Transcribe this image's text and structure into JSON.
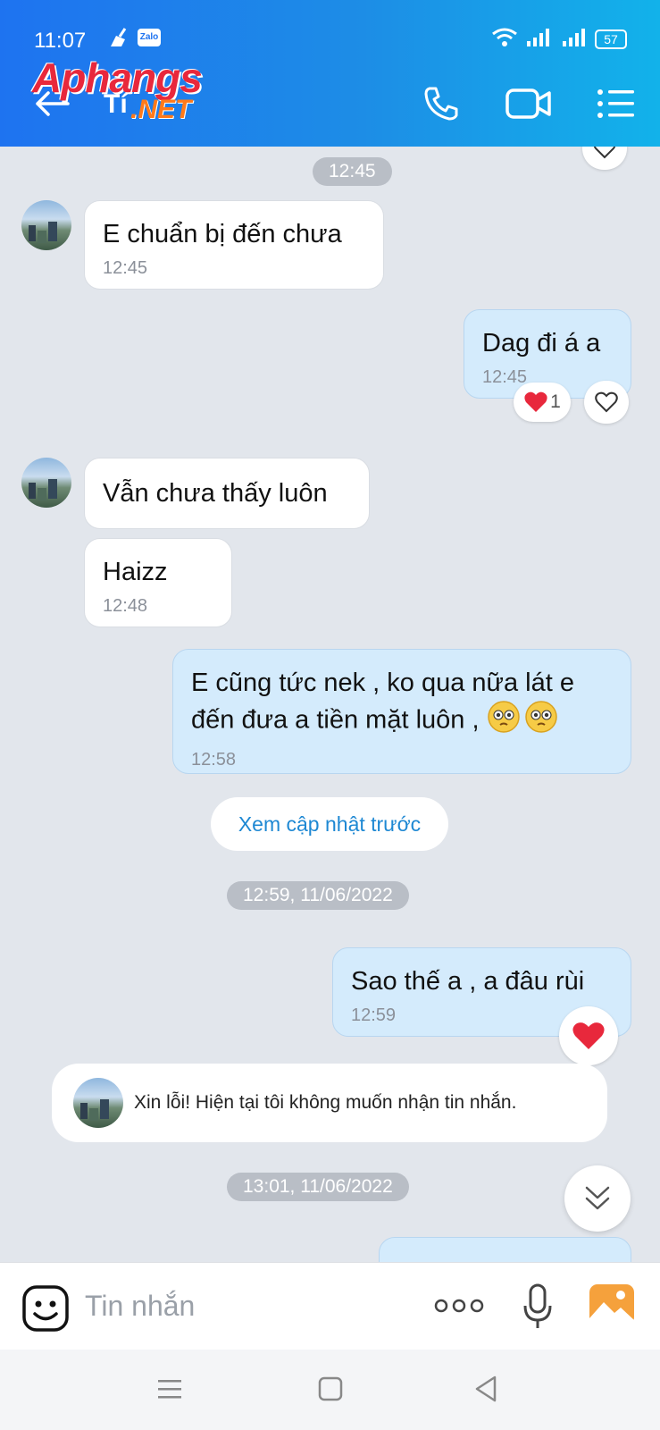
{
  "status_bar": {
    "time": "11:07",
    "battery": "57",
    "app_badge": "Zalo"
  },
  "header": {
    "watermark_main": "Aphangs",
    "watermark_sub1": "Tí",
    "watermark_sub2": ".NET",
    "icons": [
      "back-arrow-icon",
      "phone-icon",
      "video-call-icon",
      "menu-list-icon"
    ]
  },
  "chat": {
    "time_divider_1": "12:45",
    "msg1": {
      "text": "E chuẩn bị đến chưa",
      "time": "12:45"
    },
    "msg2": {
      "text": "Dag đi á a",
      "time": "12:45",
      "reaction_count": "1"
    },
    "msg3": {
      "text": "Vẫn chưa thấy luôn"
    },
    "msg4": {
      "text": "Haizz",
      "time": "12:48"
    },
    "msg5": {
      "line1": "E cũng tức nek , ko qua nữa lát e",
      "line2": "đến đưa a tiền mặt luôn ,",
      "time": "12:58"
    },
    "load_previous": "Xem cập nhật trước",
    "time_divider_2": "12:59, 11/06/2022",
    "msg6": {
      "text": "Sao thế a  , a đâu rùi",
      "time": "12:59"
    },
    "auto_reply": "Xin lỗi! Hiện tại tôi không muốn nhận tin nhắn.",
    "time_divider_3": "13:01, 11/06/2022"
  },
  "composer": {
    "placeholder": "Tin nhắn"
  },
  "colors": {
    "header_start": "#1e73f0",
    "header_end": "#12b2ea",
    "outgoing_bubble": "#d4ebfc",
    "link": "#1e88d3",
    "heart": "#e8283c"
  }
}
